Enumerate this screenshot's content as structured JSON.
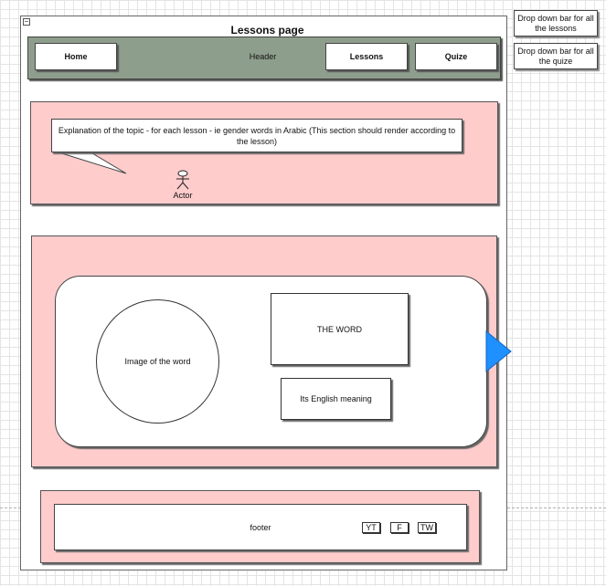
{
  "page": {
    "title": "Lessons page"
  },
  "header": {
    "label": "Header",
    "nav": {
      "home": "Home",
      "lessons": "Lessons",
      "quiz": "Quize"
    }
  },
  "topic": {
    "explanation": "Explanation of the topic -  for each lesson - ie gender words in Arabic (This section should render according to the lesson)",
    "actor_label": "Actor"
  },
  "lesson_card": {
    "image_label": "Image of the word",
    "word_label": "THE WORD",
    "meaning_label": "Its English meaning",
    "next_arrow_color": "#1e90ff"
  },
  "footer": {
    "label": "footer",
    "social": {
      "yt": "YT",
      "f": "F",
      "tw": "TW"
    }
  },
  "notes": {
    "lessons_dropdown": "Drop down bar for all the lessons",
    "quiz_dropdown": "Drop down bar for all the quize"
  },
  "colors": {
    "header_bg": "#8e9e8d",
    "section_bg": "#ffcccc"
  }
}
